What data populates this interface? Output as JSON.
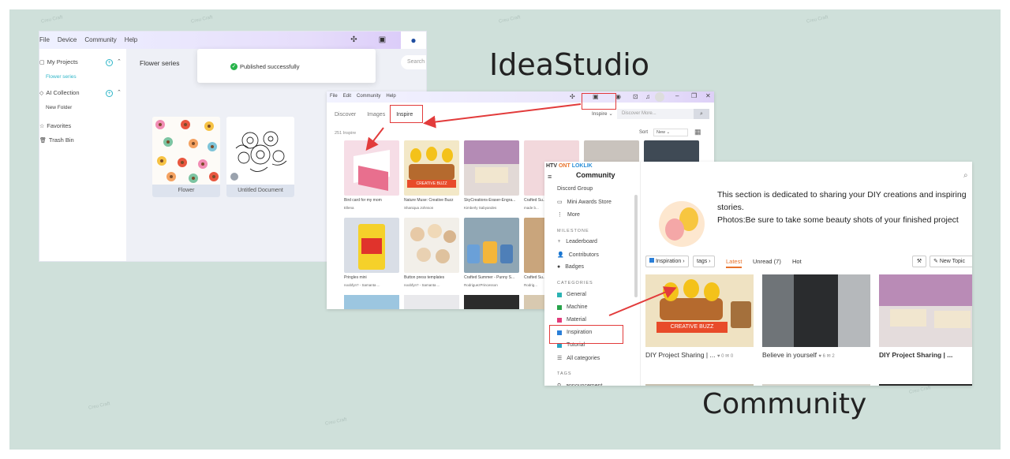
{
  "banner": {
    "title_ideastudio": "IdeaStudio",
    "title_community": "Community",
    "watermark": "Creu Craft"
  },
  "ideastudio": {
    "menu": [
      "File",
      "Device",
      "Community",
      "Help"
    ],
    "sidebar": {
      "my_projects": "My Projects",
      "flower_series": "Flower series",
      "ai_collection": "AI Collection",
      "new_folder": "New Folder",
      "favorites": "Favorites",
      "trash_bin": "Trash Bin"
    },
    "breadcrumb": "Flower series",
    "search_placeholder": "Search",
    "toast": "Published successfully",
    "cards": [
      {
        "caption": "Flower"
      },
      {
        "caption": "Untitled Document"
      }
    ]
  },
  "inspire": {
    "menu": [
      "File",
      "Edit",
      "Community",
      "Help"
    ],
    "tabs": [
      "Discover",
      "Images",
      "Inspire"
    ],
    "dropdown": "Inspire",
    "search_placeholder": "Discover More...",
    "count": "251 Inspire",
    "sort_label": "Sort",
    "sort_value": "New",
    "cards": [
      {
        "title": "Bird card for my mom",
        "user": "Ellena"
      },
      {
        "title": "Nature Muse: Creative Buzz",
        "user": "Shaniqua Johnson"
      },
      {
        "title": "SkyCreations-Eraser-Engra...",
        "user": "Kimberly Sabyandes"
      },
      {
        "title": "Crafted Su...",
        "user": "made b..."
      },
      {
        "title": "Pringles mini",
        "user": "noobfyn? - Samanta ..."
      },
      {
        "title": "Button press templates",
        "user": "noobfyn? - Samanta ..."
      },
      {
        "title": "Crafted Summer - Punny S...",
        "user": "RodriguezPrincesson"
      },
      {
        "title": "Crafted Su...",
        "user": "Rodrig..."
      }
    ]
  },
  "community": {
    "logo_text": "HTV",
    "logo_brand": "ONT",
    "logo_partner": "LOKLIK",
    "logo_sub": "Community",
    "sidebar": {
      "discord": "Discord Group",
      "mini_awards": "Mini Awards Store",
      "more": "More",
      "milestone_header": "MILESTONE",
      "leaderboard": "Leaderboard",
      "contributors": "Contributors",
      "badges": "Badges",
      "categories_header": "CATEGORIES",
      "general": "General",
      "machine": "Machine",
      "material": "Material",
      "inspiration": "Inspiration",
      "tutorial": "Tutorial",
      "all_categories": "All categories",
      "tags_header": "TAGS",
      "announcement": "announcement"
    },
    "description_line1": "This section is dedicated to sharing your DIY creations and inspiring",
    "description_line2": "stories.",
    "description_line3": "Photos:Be sure to take some beauty shots of your finished project",
    "filter_category": "Inspiration",
    "filter_tags": "tags",
    "tabs": [
      "Latest",
      "Unread (7)",
      "Hot"
    ],
    "new_topic": "New Topic",
    "cards": [
      {
        "title": "DIY Project Sharing | ...",
        "likes": "0",
        "comments": "0"
      },
      {
        "title": "Believe in yourself",
        "likes": "6",
        "comments": "2"
      },
      {
        "title": "DIY Project Sharing | ...",
        "likes": "",
        "comments": ""
      }
    ]
  },
  "colors": {
    "background": "#cfe0da",
    "accent_teal": "#2fb6c8",
    "highlight_red": "#e23b3b",
    "active_tab": "#e8722b"
  }
}
